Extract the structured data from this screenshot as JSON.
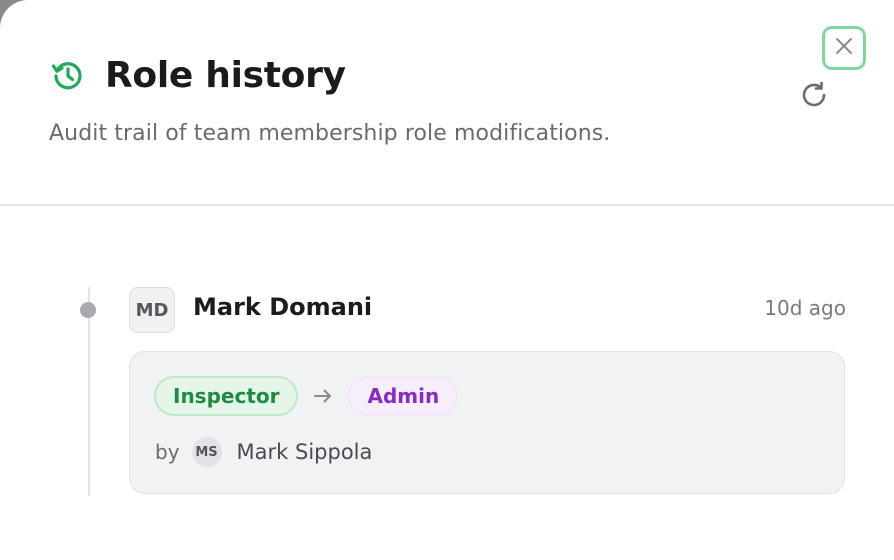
{
  "header": {
    "title": "Role history",
    "subtitle": "Audit trail of team membership role modifications.",
    "icons": {
      "title": "history-icon",
      "close": "close-icon",
      "refresh": "refresh-icon"
    }
  },
  "timeline": {
    "entries": [
      {
        "initials": "MD",
        "name": "Mark Domani",
        "time": "10d ago",
        "from_role": "Inspector",
        "to_role": "Admin",
        "arrow_icon": "arrow-right-icon",
        "by_label": "by",
        "by_initials": "MS",
        "by_name": "Mark Sippola"
      }
    ]
  },
  "colors": {
    "accent": "#1faa59",
    "focus_ring": "#7fd79c",
    "from_role": "#1e8a43",
    "to_role": "#8a2cc0"
  }
}
